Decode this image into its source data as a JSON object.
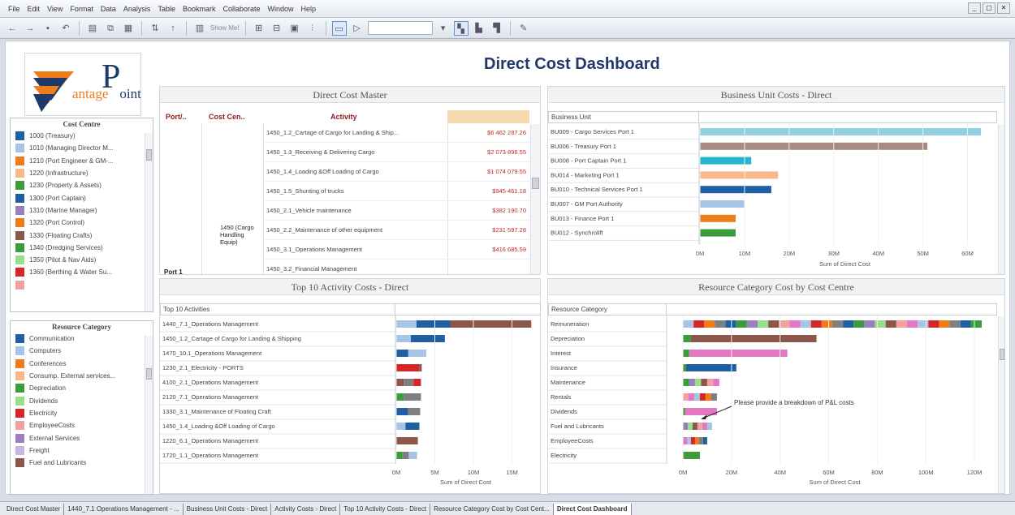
{
  "menu": [
    "File",
    "Edit",
    "View",
    "Format",
    "Data",
    "Analysis",
    "Table",
    "Bookmark",
    "Collaborate",
    "Window",
    "Help"
  ],
  "toolbar": {
    "show_me": "Show Me!"
  },
  "window_controls": {
    "minimize": "_",
    "restore": "▢",
    "close": "✕"
  },
  "logo": {
    "text": "antage",
    "letter": "P",
    "suffix": "oint"
  },
  "dashboard_title": "Direct Cost Dashboard",
  "cost_centre_legend": {
    "title": "Cost Centre",
    "items": [
      {
        "label": "1000 (Treasury)",
        "color": "#1f5fa3"
      },
      {
        "label": "1010 (Managing Director M...",
        "color": "#a6c4e6"
      },
      {
        "label": "1210 (Port Engineer & GM-...",
        "color": "#ef7c1a"
      },
      {
        "label": "1220 (Infrastructure)",
        "color": "#f7b98a"
      },
      {
        "label": "1230 (Property & Assets)",
        "color": "#3a9d3a"
      },
      {
        "label": "1300 (Port Captain)",
        "color": "#1f5fa3"
      },
      {
        "label": "1310 (Marine Manager)",
        "color": "#9a7fc0"
      },
      {
        "label": "1320 (Port Control)",
        "color": "#ef7c1a"
      },
      {
        "label": "1330 (Floating Crafts)",
        "color": "#8c564b"
      },
      {
        "label": "1340 (Dredging Services)",
        "color": "#3a9d3a"
      },
      {
        "label": "1350 (Pilot & Nav Aids)",
        "color": "#98df8a"
      },
      {
        "label": "1360 (Berthing & Water Su...",
        "color": "#d62728"
      },
      {
        "label": "",
        "color": "#f4a0a0"
      }
    ]
  },
  "resource_legend": {
    "title": "Resource Category",
    "items": [
      {
        "label": "Communication",
        "color": "#1f5fa3"
      },
      {
        "label": "Computers",
        "color": "#a6c4e6"
      },
      {
        "label": "Conferences",
        "color": "#ef7c1a"
      },
      {
        "label": "Consump. External services...",
        "color": "#f7b98a"
      },
      {
        "label": "Depreciation",
        "color": "#3a9d3a"
      },
      {
        "label": "Dividends",
        "color": "#98df8a"
      },
      {
        "label": "Electricity",
        "color": "#d62728"
      },
      {
        "label": "EmployeeCosts",
        "color": "#f4a0a0"
      },
      {
        "label": "External Services",
        "color": "#9a7fc0"
      },
      {
        "label": "Freight",
        "color": "#c9b6e0"
      },
      {
        "label": "Fuel and Lubricants",
        "color": "#8c564b"
      }
    ]
  },
  "direct_cost_master": {
    "title": "Direct Cost Master",
    "headers": [
      "Port/..",
      "Cost Cen..",
      "Activity"
    ],
    "port": "Port 1",
    "cost_centre": "1450 (Cargo Handling Equip)",
    "rows": [
      {
        "activity": "1450_1.2_Cartage of Cargo for Landing & Ship...",
        "value": "$6 462 287.26"
      },
      {
        "activity": "1450_1.3_Receiving & Delivering Cargo",
        "value": "$2 073 896.55"
      },
      {
        "activity": "1450_1.4_Loading &Off Loading of Cargo",
        "value": "$1 074 079.55"
      },
      {
        "activity": "1450_1.5_Shunting of trucks",
        "value": "$945 461.18"
      },
      {
        "activity": "1450_2.1_Vehicle maintenance",
        "value": "$382 190.70"
      },
      {
        "activity": "1450_2.2_Maintenance of other equipment",
        "value": "$231 597.28"
      },
      {
        "activity": "1450_3.1_Operations Management",
        "value": "$416 685.59"
      },
      {
        "activity": "1450_3.2_Financial Management",
        "value": ""
      }
    ]
  },
  "business_unit": {
    "title": "Business Unit Costs - Direct",
    "header": "Business Unit",
    "xlabel": "Sum of Direct Cost",
    "ticks": [
      "0M",
      "10M",
      "20M",
      "30M",
      "40M",
      "50M",
      "60M"
    ]
  },
  "top10": {
    "title": "Top 10 Activity Costs - Direct",
    "header": "Top 10 Activities",
    "xlabel": "Sum of Direct Cost",
    "ticks": [
      "0M",
      "5M",
      "10M",
      "15M"
    ]
  },
  "resource_chart": {
    "title": "Resource Category Cost by Cost Centre",
    "header": "Resource Category",
    "xlabel": "Sum of Direct Cost",
    "ticks": [
      "0M",
      "20M",
      "40M",
      "60M",
      "80M",
      "100M",
      "120M"
    ],
    "annotation": "Please provide a breakdown of P&L costs"
  },
  "chart_data": [
    {
      "type": "bar",
      "title": "Business Unit Costs - Direct",
      "xlabel": "Sum of Direct Cost",
      "categories": [
        "BU009 - Cargo Services Port 1",
        "BU006 - Treasury Port 1",
        "BU008 - Port Captain Port 1",
        "BU014 - Marketing Port 1",
        "BU010 - Technical Services Port 1",
        "BU007 - GM Port Authority",
        "BU013 - Finance Port 1",
        "BU012 - Synchrolift"
      ],
      "values": [
        63,
        51,
        11.5,
        17.5,
        16,
        10,
        8,
        8
      ],
      "colors": [
        "#8fd0e4",
        "#a98a82",
        "#24b5d0",
        "#f7b98a",
        "#1f5fa3",
        "#a6c4e6",
        "#ef7c1a",
        "#3a9d3a"
      ],
      "xlim": [
        0,
        65
      ]
    },
    {
      "type": "bar",
      "title": "Top 10 Activity Costs - Direct",
      "xlabel": "Sum of Direct Cost",
      "categories": [
        "1440_7.1_Operations Management",
        "1450_1.2_Cartage of Cargo for Landing & Shipping",
        "1470_10.1_Operations Management",
        "1230_2.1_Electricity - PORTS",
        "4100_2.1_Operations Management",
        "2120_7.1_Operations Management",
        "1330_3.1_Maintenance of Floating Craft",
        "1450_1.4_Loading &Off Loading of Cargo",
        "1220_6.1_Operations Management",
        "1720_1.1_Operations Management"
      ],
      "values": [
        17.5,
        6.3,
        3.9,
        3.3,
        3.2,
        3.2,
        3.1,
        3.0,
        2.8,
        2.7
      ],
      "xlim": [
        0,
        18
      ]
    },
    {
      "type": "bar",
      "title": "Resource Category Cost by Cost Centre",
      "xlabel": "Sum of Direct Cost",
      "categories": [
        "Remuneration",
        "Depreciation",
        "Interest",
        "Insurance",
        "Maintenance",
        "Rentals",
        "Dividends",
        "Fuel and Lubricants",
        "EmployeeCosts",
        "Electricity"
      ],
      "values": [
        123,
        55,
        43,
        22,
        15,
        14,
        14,
        12,
        10,
        7
      ],
      "xlim": [
        0,
        125
      ]
    }
  ],
  "tabs": [
    "Direct Cost Master",
    "1440_7.1 Operations Management - ...",
    "Business Unit Costs - Direct",
    "Activity Costs - Direct",
    "Top 10 Activity Costs - Direct",
    "Resource Category Cost by Cost Cent...",
    "Direct Cost Dashboard"
  ]
}
